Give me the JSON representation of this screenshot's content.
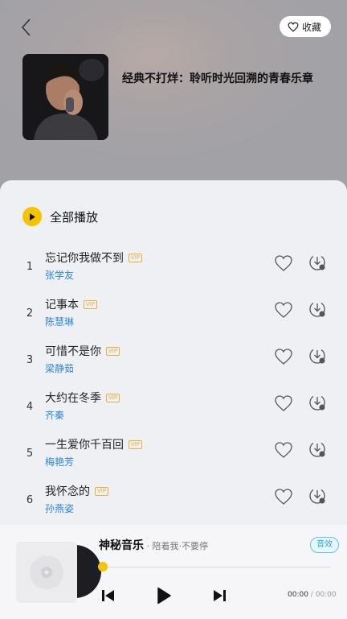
{
  "header": {
    "favorite_label": "收藏",
    "playlist_title": "经典不打烊：聆听时光回溯的青春乐章"
  },
  "list": {
    "play_all_label": "全部播放",
    "vip_label": "VIP",
    "songs": [
      {
        "index": "1",
        "title": "忘记你我做不到",
        "artist": "张学友"
      },
      {
        "index": "2",
        "title": "记事本",
        "artist": "陈慧琳"
      },
      {
        "index": "3",
        "title": "可惜不是你",
        "artist": "梁静茹"
      },
      {
        "index": "4",
        "title": "大约在冬季",
        "artist": "齐秦"
      },
      {
        "index": "5",
        "title": "一生爱你千百回",
        "artist": "梅艳芳"
      },
      {
        "index": "6",
        "title": "我怀念的",
        "artist": "孙燕姿"
      }
    ]
  },
  "player": {
    "title": "神秘音乐",
    "subtitle": " · 陪着我·不要停",
    "sound_badge": "音效",
    "current_time": "00:00",
    "total_time": " / 00:00",
    "progress": 0
  },
  "colors": {
    "accent": "#f5c400",
    "artist_link": "#2d86d6",
    "vip": "#e8b23a"
  }
}
